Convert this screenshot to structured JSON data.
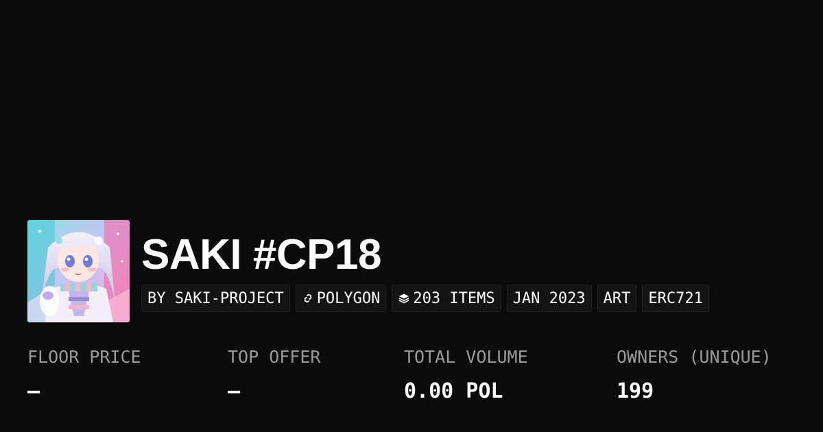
{
  "collection": {
    "name": "SAKI #CP18",
    "avatar_icon": "anime-character-avatar"
  },
  "tags": [
    {
      "label": "BY SAKI-PROJECT",
      "icon": null
    },
    {
      "label": "POLYGON",
      "icon": "polygon-chain-icon"
    },
    {
      "label": "203 ITEMS",
      "icon": "layers-icon"
    },
    {
      "label": "JAN 2023",
      "icon": null
    },
    {
      "label": "ART",
      "icon": null
    },
    {
      "label": "ERC721",
      "icon": null
    }
  ],
  "stats": {
    "floor_price": {
      "label": "FLOOR PRICE",
      "value": "–"
    },
    "top_offer": {
      "label": "TOP OFFER",
      "value": "–"
    },
    "total_volume": {
      "label": "TOTAL VOLUME",
      "value": "0.00 POL"
    },
    "owners": {
      "label": "OWNERS (UNIQUE)",
      "value": "199"
    }
  },
  "colors": {
    "background": "#0b0b0b",
    "text": "#ffffff",
    "muted_text": "#9a9a9a",
    "tag_background": "#141414",
    "tag_border": "#232323"
  }
}
